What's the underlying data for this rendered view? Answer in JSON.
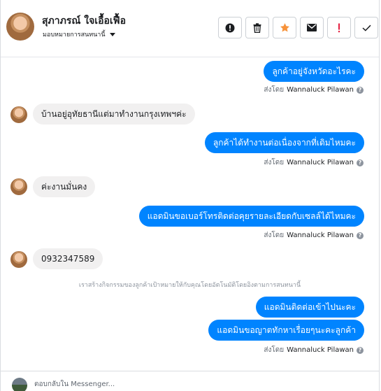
{
  "header": {
    "contact_name": "สุภาภรณ์ ใจเอื้อเฟื้อ",
    "assign_label": "มอบหมายการสนทนานี้",
    "actions": [
      {
        "icon": "alert-circle-icon"
      },
      {
        "icon": "trash-icon"
      },
      {
        "icon": "star-icon",
        "color": "#f7923a"
      },
      {
        "icon": "envelope-icon"
      },
      {
        "icon": "exclamation-icon",
        "color": "#e41e3f"
      },
      {
        "icon": "checkmark-icon"
      }
    ]
  },
  "messages": {
    "m1": "ลูกค้าอยู่จังหวัดอะไรคะ",
    "m2": "บ้านอยู่อุทัยธานีแต่มาทำงานกรุงเทพฯค่ะ",
    "m3": "ลูกค้าได้ทำงานต่อเนื่องจากที่เดิมไหมคะ",
    "m4": "ค่ะงานมั่นคง",
    "m5": "แอดมินขอเบอร์โทรติดต่อคุยรายละเอียดกับเซลล์ได้ไหมคะ",
    "m6": "0932347589",
    "system_note": "เราสร้างกิจกรรมของลูกค้าเป้าหมายให้กับคุณโดยอัตโนมัติโดยอิงตามการสนทนานี้",
    "m7": "แอดมินติดต่อเข้าไปนะคะ",
    "m8": "แอดมินขอญาตทักหาเรื่อยๆนะคะลูกค้า"
  },
  "sent_by": {
    "prefix": "ส่งโดย",
    "agent": "Wannaluck Pilawan"
  },
  "reply": {
    "placeholder": "ตอบกลับใน Messenger..."
  },
  "colors": {
    "outgoing_bubble": "#0084ff",
    "incoming_bubble": "#f1f0f0"
  }
}
